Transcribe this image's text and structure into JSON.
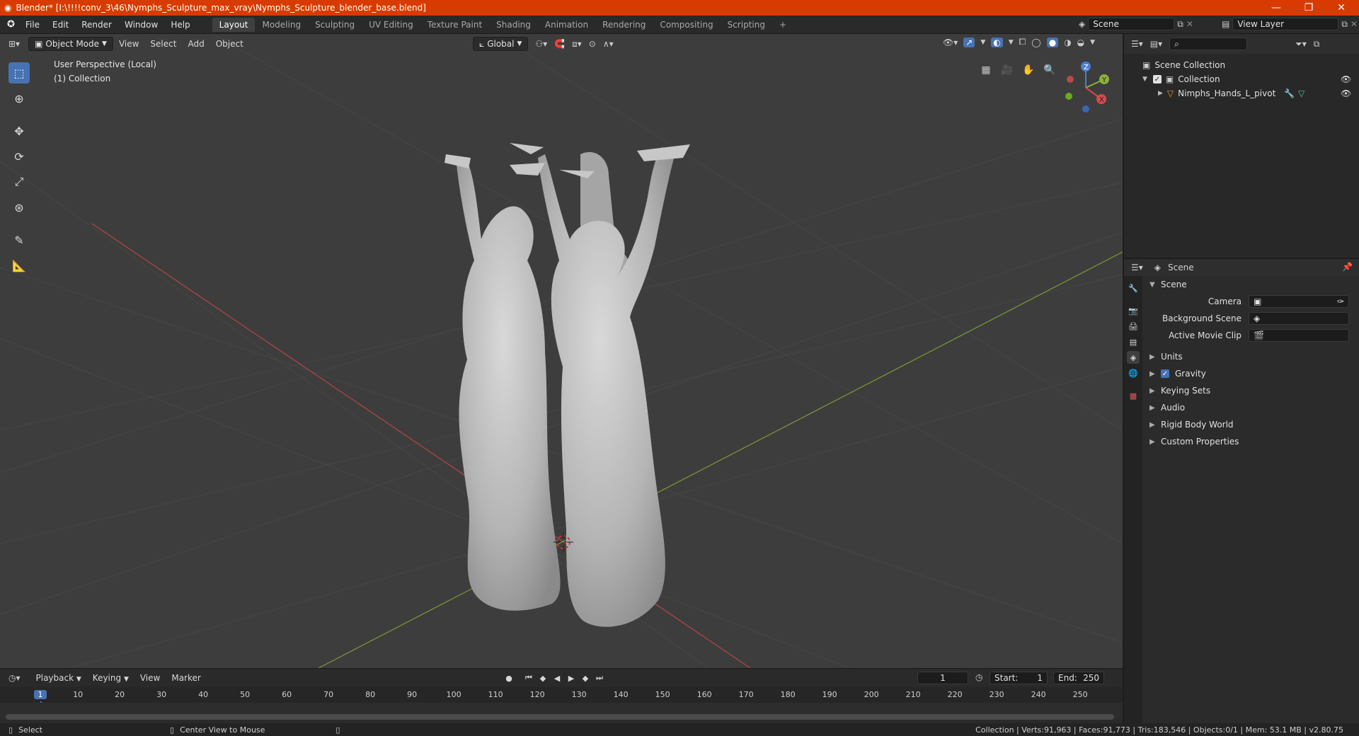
{
  "window": {
    "title": "Blender* [I:\\!!!!conv_3\\46\\Nymphs_Sculpture_max_vray\\Nymphs_Sculpture_blender_base.blend]",
    "minimize": "—",
    "maximize": "❐",
    "close": "✕"
  },
  "menu": [
    "File",
    "Edit",
    "Render",
    "Window",
    "Help"
  ],
  "workspaces": [
    "Layout",
    "Modeling",
    "Sculpting",
    "UV Editing",
    "Texture Paint",
    "Shading",
    "Animation",
    "Rendering",
    "Compositing",
    "Scripting"
  ],
  "workspace_add": "+",
  "scene_field": "Scene",
  "view_layer_field": "View Layer",
  "viewport": {
    "mode": "Object Mode",
    "menus": [
      "View",
      "Select",
      "Add",
      "Object"
    ],
    "orientation": "Global",
    "perspective_label": "User Perspective (Local)",
    "collection_label": "(1) Collection",
    "gizmo": {
      "x": "X",
      "y": "Y",
      "z": "Z"
    }
  },
  "outliner": {
    "root": "Scene Collection",
    "collection": "Collection",
    "object": "Nimphs_Hands_L_pivot"
  },
  "properties": {
    "context_name": "Scene",
    "section_title": "Scene",
    "camera_label": "Camera",
    "background_scene_label": "Background Scene",
    "active_movie_clip_label": "Active Movie Clip",
    "panels": [
      "Units",
      "Gravity",
      "Keying Sets",
      "Audio",
      "Rigid Body World",
      "Custom Properties"
    ],
    "gravity_checked": true
  },
  "timeline": {
    "menus": [
      "Playback",
      "Keying",
      "View",
      "Marker"
    ],
    "current_frame": "1",
    "start_label": "Start:",
    "start_value": "1",
    "end_label": "End:",
    "end_value": "250",
    "ruler": [
      "1",
      "10",
      "20",
      "30",
      "40",
      "50",
      "60",
      "70",
      "80",
      "90",
      "100",
      "110",
      "120",
      "130",
      "140",
      "150",
      "160",
      "170",
      "180",
      "190",
      "200",
      "210",
      "220",
      "230",
      "240",
      "250"
    ]
  },
  "status": {
    "left_action": "Select",
    "middle_action": "Center View to Mouse",
    "stats": "Collection | Verts:91,963 | Faces:91,773 | Tris:183,546 | Objects:0/1 | Mem: 53.1 MB | v2.80.75"
  },
  "colors": {
    "titlebar": "#d83b01",
    "accent": "#4772b3",
    "viewport_bg": "#3d3d3d",
    "x_axis": "#c04444",
    "y_axis": "#7a9a2e"
  }
}
